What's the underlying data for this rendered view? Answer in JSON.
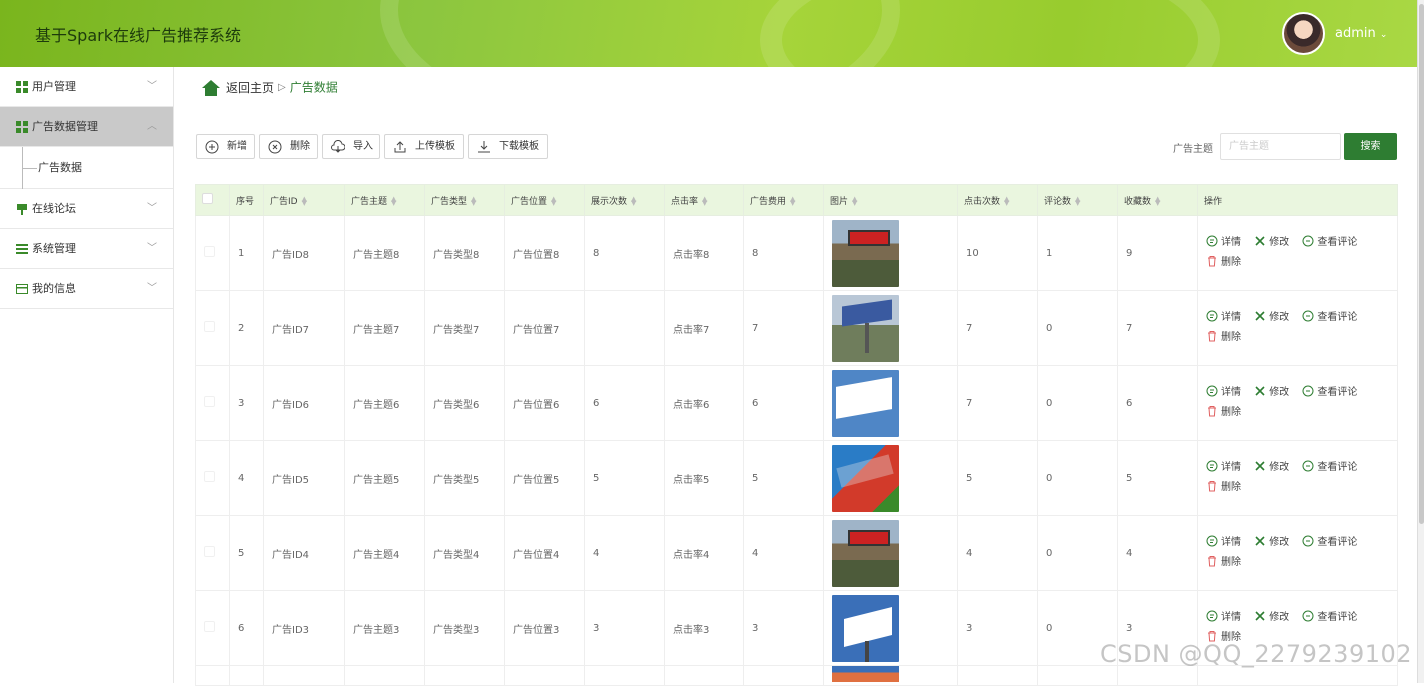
{
  "app": {
    "title": "基于Spark在线广告推荐系统",
    "user": "admin"
  },
  "sidebar": {
    "items": [
      {
        "label": "用户管理",
        "icon": "grid-icon"
      },
      {
        "label": "广告数据管理",
        "icon": "grid-icon",
        "active": true,
        "children": [
          {
            "label": "广告数据"
          }
        ]
      },
      {
        "label": "在线论坛",
        "icon": "forum-icon"
      },
      {
        "label": "系统管理",
        "icon": "list-icon"
      },
      {
        "label": "我的信息",
        "icon": "card-icon"
      }
    ]
  },
  "breadcrumb": {
    "home": "返回主页",
    "current": "广告数据"
  },
  "toolbar": {
    "add": "新增",
    "delete": "删除",
    "import": "导入",
    "upload": "上传模板",
    "download": "下载模板"
  },
  "search": {
    "label": "广告主题",
    "placeholder": "广告主题",
    "button": "搜索"
  },
  "table": {
    "headers": [
      "序号",
      "广告ID",
      "广告主题",
      "广告类型",
      "广告位置",
      "展示次数",
      "点击率",
      "广告费用",
      "图片",
      "点击次数",
      "评论数",
      "收藏数",
      "操作"
    ],
    "actions": {
      "detail": "详情",
      "edit": "修改",
      "comments": "查看评论",
      "delete": "删除"
    },
    "rows": [
      {
        "no": "1",
        "id": "广告ID8",
        "theme": "广告主题8",
        "type": "广告类型8",
        "position": "广告位置8",
        "views": "8",
        "ctr": "点击率8",
        "cost": "8",
        "clicks": "10",
        "comments": "1",
        "favorites": "9"
      },
      {
        "no": "2",
        "id": "广告ID7",
        "theme": "广告主题7",
        "type": "广告类型7",
        "position": "广告位置7",
        "views": "",
        "ctr": "点击率7",
        "cost": "7",
        "clicks": "7",
        "comments": "0",
        "favorites": "7"
      },
      {
        "no": "3",
        "id": "广告ID6",
        "theme": "广告主题6",
        "type": "广告类型6",
        "position": "广告位置6",
        "views": "6",
        "ctr": "点击率6",
        "cost": "6",
        "clicks": "7",
        "comments": "0",
        "favorites": "6"
      },
      {
        "no": "4",
        "id": "广告ID5",
        "theme": "广告主题5",
        "type": "广告类型5",
        "position": "广告位置5",
        "views": "5",
        "ctr": "点击率5",
        "cost": "5",
        "clicks": "5",
        "comments": "0",
        "favorites": "5"
      },
      {
        "no": "5",
        "id": "广告ID4",
        "theme": "广告主题4",
        "type": "广告类型4",
        "position": "广告位置4",
        "views": "4",
        "ctr": "点击率4",
        "cost": "4",
        "clicks": "4",
        "comments": "0",
        "favorites": "4"
      },
      {
        "no": "6",
        "id": "广告ID3",
        "theme": "广告主题3",
        "type": "广告类型3",
        "position": "广告位置3",
        "views": "3",
        "ctr": "点击率3",
        "cost": "3",
        "clicks": "3",
        "comments": "0",
        "favorites": "3"
      }
    ]
  },
  "watermark": "CSDN @QQ_2279239102",
  "colors": {
    "brand": "#2e7d32",
    "header": "#8cc63f",
    "header_bg": "#eaf6df"
  }
}
